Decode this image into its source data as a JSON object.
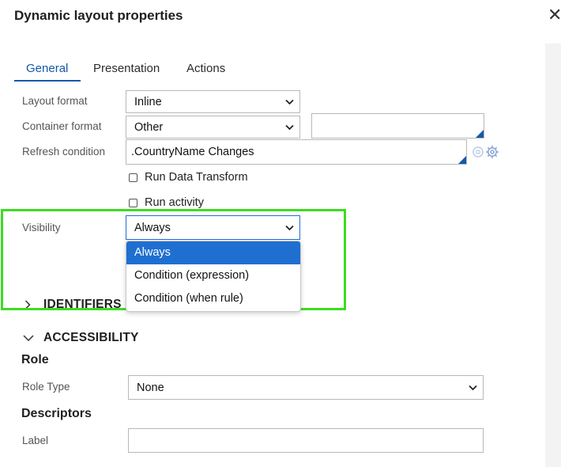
{
  "dialog": {
    "title": "Dynamic layout properties",
    "close_glyph": "✕"
  },
  "tabs": [
    {
      "label": "General",
      "active": true
    },
    {
      "label": "Presentation",
      "active": false
    },
    {
      "label": "Actions",
      "active": false
    }
  ],
  "general": {
    "layout_format": {
      "label": "Layout format",
      "value": "Inline"
    },
    "container_format": {
      "label": "Container format",
      "value": "Other",
      "extra_value": ""
    },
    "refresh_condition": {
      "label": "Refresh condition",
      "value": ".CountryName Changes"
    },
    "run_data_transform": {
      "label": "Run Data Transform",
      "checked": false
    },
    "run_activity": {
      "label": "Run activity",
      "checked": false
    },
    "visibility": {
      "label": "Visibility",
      "value": "Always",
      "options": [
        "Always",
        "Condition (expression)",
        "Condition (when rule)"
      ]
    }
  },
  "sections": {
    "identifiers": {
      "title": "IDENTIFIERS",
      "expanded": false
    },
    "accessibility": {
      "title": "ACCESSIBILITY",
      "expanded": true
    }
  },
  "accessibility": {
    "role_heading": "Role",
    "role_type": {
      "label": "Role Type",
      "value": "None"
    },
    "descriptors_heading": "Descriptors",
    "label_field": {
      "label": "Label",
      "value": ""
    }
  },
  "colors": {
    "accent": "#1558a8",
    "selected_option": "#1f6fd1",
    "highlight_border": "#3ddc22"
  },
  "icons": [
    "close-icon",
    "chevron-down-icon",
    "gear-icon",
    "chevron-right-icon"
  ]
}
